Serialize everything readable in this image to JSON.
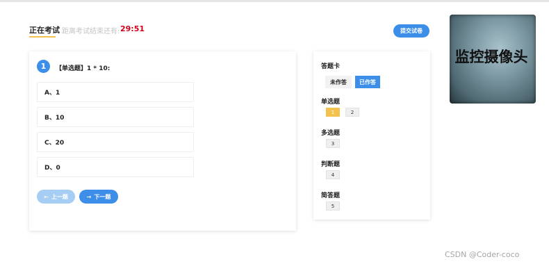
{
  "header": {
    "status_tab": "正在考试",
    "timer_label": "距离考试结束还有:",
    "timer_value": "29:51",
    "submit_label": "提交试卷"
  },
  "camera": {
    "label": "监控摄像头"
  },
  "question": {
    "number": "1",
    "text": "【单选题】1 * 10:",
    "options": [
      "A、1",
      "B、10",
      "C、20",
      "D、0"
    ]
  },
  "nav": {
    "prev_label": "上一题",
    "next_label": "下一题"
  },
  "answer_card": {
    "title": "答题卡",
    "legend_unanswered": "未作答",
    "legend_answered": "已作答",
    "sections": [
      {
        "title": "单选题",
        "items": [
          "1",
          "2"
        ]
      },
      {
        "title": "多选题",
        "items": [
          "3"
        ]
      },
      {
        "title": "判断题",
        "items": [
          "4"
        ]
      },
      {
        "title": "简答题",
        "items": [
          "5"
        ]
      }
    ]
  },
  "watermark": "CSDN @Coder-coco",
  "colors": {
    "accent": "#3d8ee8",
    "answered": "#f2c14e",
    "timer": "#d0021b"
  }
}
